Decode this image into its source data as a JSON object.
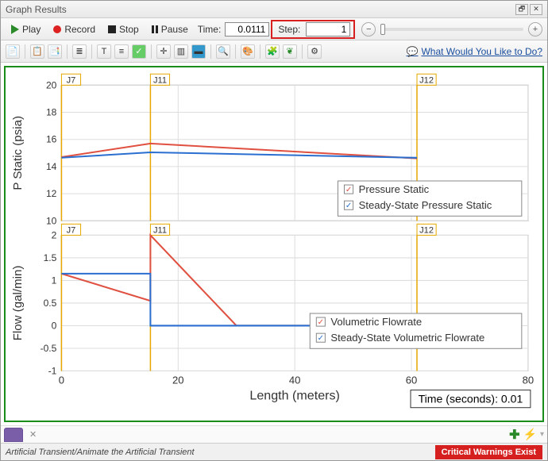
{
  "window": {
    "title": "Graph Results"
  },
  "playback": {
    "play": "Play",
    "record": "Record",
    "stop": "Stop",
    "pause": "Pause",
    "time_label": "Time:",
    "time_value": "0.0111",
    "step_label": "Step:",
    "step_value": "1"
  },
  "help": {
    "link": "What Would You Like to Do?"
  },
  "tabs": {
    "active_color": "#7a5fa8"
  },
  "status": {
    "path": "Artificial Transient/Animate the Artificial Transient",
    "warning": "Critical Warnings Exist"
  },
  "time_box": {
    "label": "Time (seconds): 0.01"
  },
  "xlabel": "Length (meters)",
  "chart_data": [
    {
      "type": "line",
      "title": "",
      "ylabel": "P Static (psia)",
      "xlabel": "Length (meters)",
      "xlim": [
        0,
        80
      ],
      "ylim": [
        10,
        20
      ],
      "xticks": [
        0,
        20,
        40,
        60,
        80
      ],
      "yticks": [
        10,
        12,
        14,
        16,
        18,
        20
      ],
      "annotations": [
        {
          "label": "J7",
          "x": 0
        },
        {
          "label": "J11",
          "x": 15.25
        },
        {
          "label": "J12",
          "x": 60.95
        }
      ],
      "series": [
        {
          "name": "Pressure Static",
          "color": "#e05040",
          "x": [
            0,
            15.25,
            60.95
          ],
          "y": [
            14.7,
            15.7,
            14.6
          ]
        },
        {
          "name": "Steady-State Pressure Static",
          "color": "#2a6fd0",
          "x": [
            0,
            15.25,
            60.95
          ],
          "y": [
            14.65,
            15.05,
            14.65
          ]
        }
      ]
    },
    {
      "type": "line",
      "title": "",
      "ylabel": "Flow (gal/min)",
      "xlabel": "Length (meters)",
      "xlim": [
        0,
        80
      ],
      "ylim": [
        -1,
        2
      ],
      "xticks": [
        0,
        20,
        40,
        60,
        80
      ],
      "yticks": [
        -1,
        -0.5,
        0,
        0.5,
        1,
        1.5,
        2
      ],
      "annotations": [
        {
          "label": "J7",
          "x": 0
        },
        {
          "label": "J11",
          "x": 15.25
        },
        {
          "label": "J12",
          "x": 60.95
        }
      ],
      "series": [
        {
          "name": "Volumetric Flowrate",
          "color": "#e05040",
          "x": [
            0,
            15.24,
            15.25,
            30,
            60.95
          ],
          "y": [
            1.15,
            0.55,
            2.0,
            0,
            0
          ]
        },
        {
          "name": "Steady-State Volumetric Flowrate",
          "color": "#2a6fd0",
          "x": [
            0,
            15.24,
            15.25,
            60.95
          ],
          "y": [
            1.15,
            1.15,
            0,
            0
          ]
        }
      ]
    }
  ]
}
